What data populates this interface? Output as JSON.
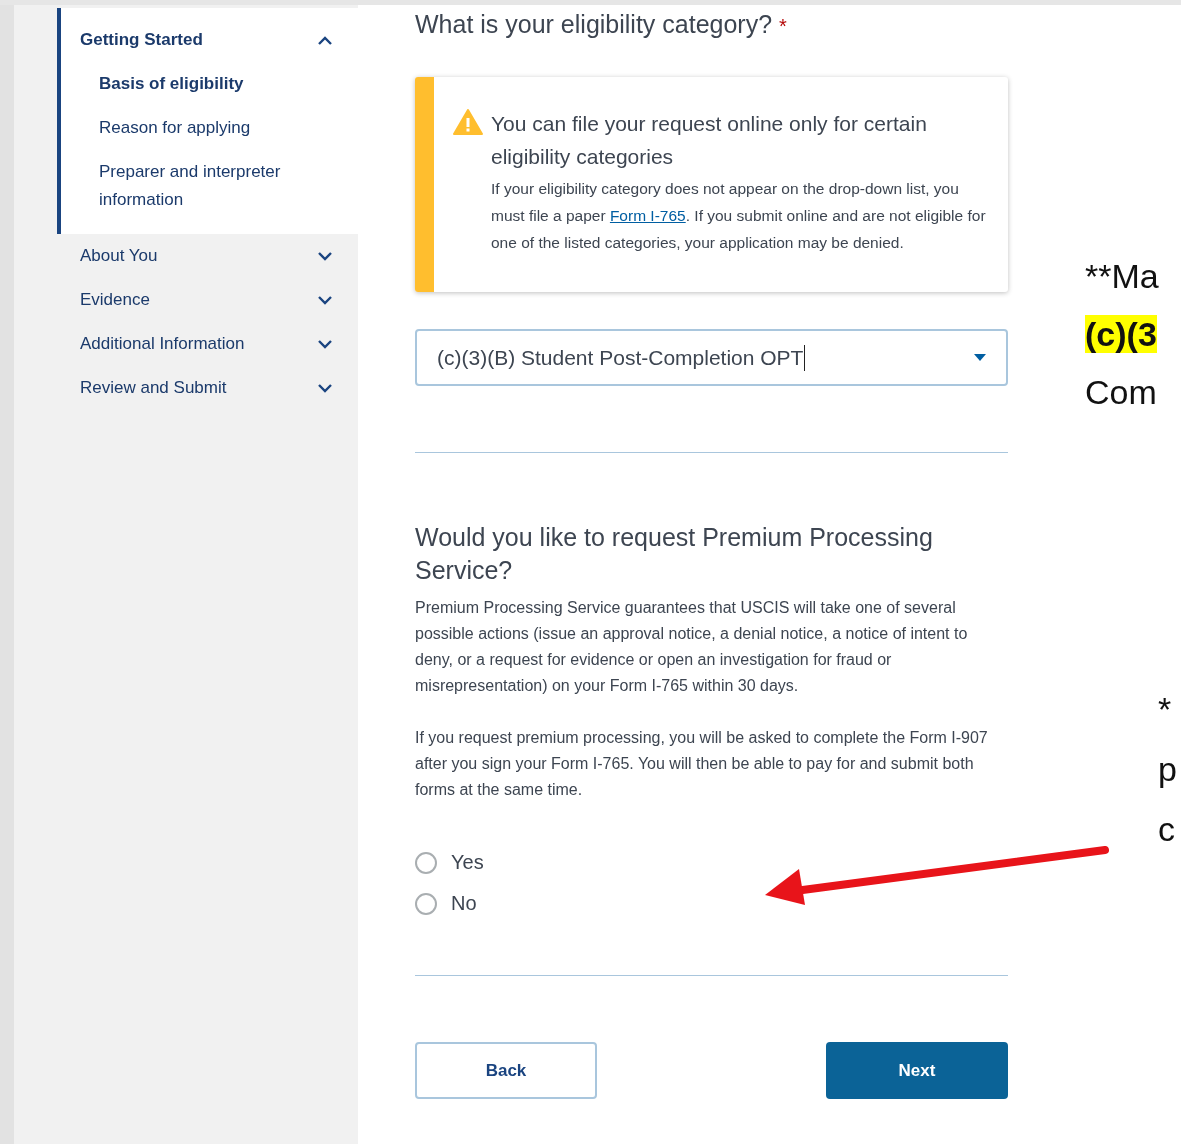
{
  "sidebar": {
    "sections": [
      {
        "label": "Getting Started",
        "expanded": true,
        "children": [
          {
            "label": "Basis of eligibility",
            "selected": true
          },
          {
            "label": "Reason for applying",
            "selected": false
          },
          {
            "label": "Preparer and interpreter information",
            "selected": false
          }
        ]
      },
      {
        "label": "About You",
        "expanded": false
      },
      {
        "label": "Evidence",
        "expanded": false
      },
      {
        "label": "Additional Information",
        "expanded": false
      },
      {
        "label": "Review and Submit",
        "expanded": false
      }
    ]
  },
  "question": {
    "label": "What is your eligibility category?",
    "required_mark": "*"
  },
  "alert": {
    "title": "You can file your request online only for certain eligibility categories",
    "text_before": "If your eligibility category does not appear on the drop-down list, you must file a paper",
    "link": "Form I-765",
    "text_after": ". If you submit online and are not eligible for one of the listed categories, your application may be denied."
  },
  "dropdown": {
    "value": "(c)(3)(B) Student Post-Completion OPT"
  },
  "premium": {
    "heading": "Would you like to request Premium Processing Service?",
    "paragraphs": [
      "Premium Processing Service guarantees that USCIS will take one of several possible actions (issue an approval notice, a denial notice, a notice of intent to deny, or a request for evidence or open an investigation for fraud or misrepresentation) on your Form I-765 within 30 days.",
      "If you request premium processing, you will be asked to complete the Form I-907 after you sign your Form I-765. You will then be able to pay for and submit both forms at the same time."
    ],
    "options": [
      {
        "label": "Yes",
        "selected": false
      },
      {
        "label": "No",
        "selected": false
      }
    ]
  },
  "buttons": {
    "back": "Back",
    "next": "Next"
  },
  "annotations": [
    {
      "text": "**Ma",
      "highlight": false,
      "bold": false
    },
    {
      "text": "(c)(3",
      "highlight": true,
      "bold": true
    },
    {
      "text": "Com",
      "highlight": false,
      "bold": false
    }
  ],
  "annotations_lower": [
    "*",
    "p",
    "c"
  ]
}
